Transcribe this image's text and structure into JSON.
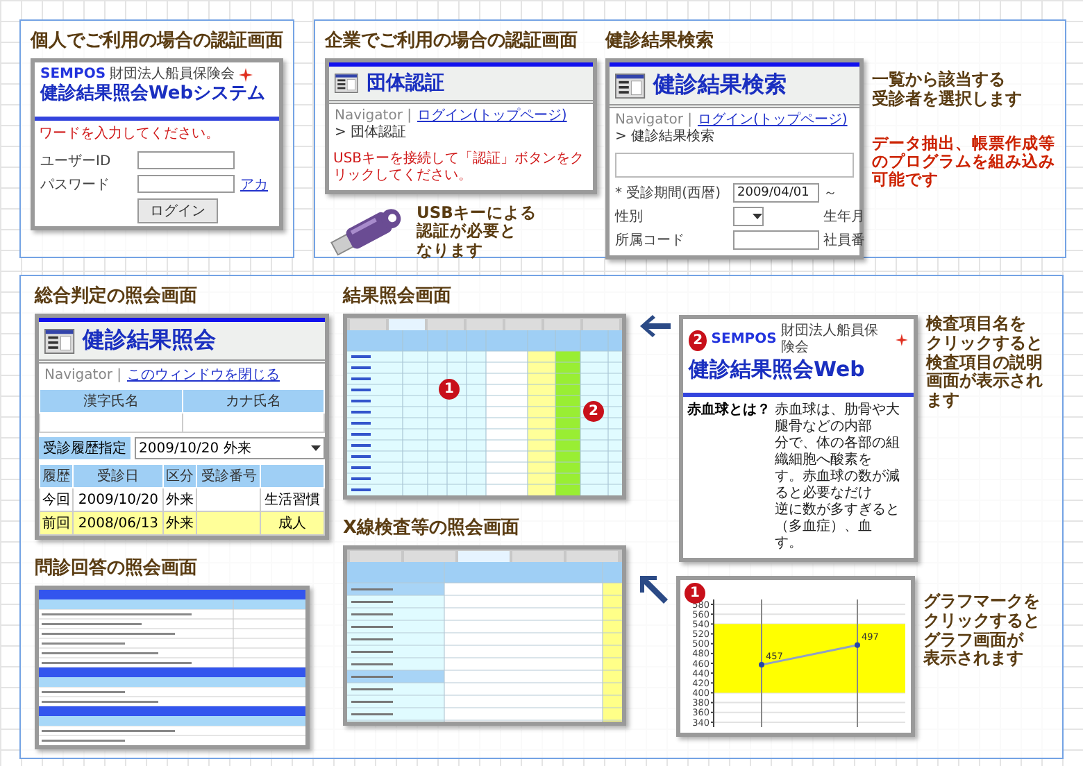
{
  "personal_auth": {
    "title": "個人でご利用の場合の認証画面",
    "brand": "SEMPOS",
    "org": "財団法人船員保険会",
    "system": "健診結果照会Webシステム",
    "message": "ワードを入力してください。",
    "fields": [
      {
        "label": "ユーザーID"
      },
      {
        "label": "パスワード"
      }
    ],
    "link": "アカ",
    "button": "ログイン"
  },
  "corporate_auth": {
    "title": "企業でご利用の場合の認証画面",
    "heading": "団体認証",
    "nav": {
      "label": "Navigator |",
      "link": "ログイン(トップページ)",
      "current": "> 団体認証"
    },
    "message": "USBキーを接続して「認証」ボタンをクリックしてください。",
    "caption": [
      "USBキーによる",
      "認証が必要と",
      "なります"
    ]
  },
  "search": {
    "title": "健診結果検索",
    "heading": "健診結果検索",
    "nav": {
      "label": "Navigator |",
      "link": "ログイン(トップページ)",
      "current": "> 健診結果検索"
    },
    "rows": [
      {
        "label": "* 受診期間(西暦)",
        "kind": "text",
        "value": "2009/04/01",
        "side": "～"
      },
      {
        "label": "性別",
        "kind": "select",
        "side": "生年月"
      },
      {
        "label": "所属コード",
        "kind": "text",
        "side": "社員番"
      }
    ],
    "caption": [
      "一覧から該当する",
      "受診者を選択します"
    ],
    "note": [
      "データ抽出、帳票作成等",
      "のプログラムを組み込み",
      "可能です"
    ]
  },
  "overall": {
    "title": "総合判定の照会画面",
    "heading": "健診結果照会",
    "nav": {
      "label": "Navigator |",
      "link": "このウィンドウを閉じる"
    },
    "name_columns": [
      "漢字氏名",
      "カナ氏名"
    ],
    "history": {
      "label": "受診履歴指定",
      "value": "2009/10/20 外来"
    },
    "columns": [
      "履歴",
      "受診日",
      "区分",
      "受診番号"
    ],
    "rows": [
      {
        "history": "今回",
        "date": "2009/10/20",
        "category": "外来",
        "column_5": "生活習慣",
        "highlighted": false
      },
      {
        "history": "前回",
        "date": "2008/06/13",
        "category": "外来",
        "column_5": "成人",
        "highlighted": true
      }
    ]
  },
  "results": {
    "title": "結果照会画面",
    "markers": [
      "1",
      "2"
    ]
  },
  "questionnaire": {
    "title": "問診回答の照会画面"
  },
  "xray": {
    "title": "X線検査等の照会画面"
  },
  "detail_popup": {
    "marker": "2",
    "brand": "SEMPOS",
    "org": "財団法人船員保険会",
    "system": "健診結果照会Web",
    "term": "赤血球とは？",
    "lines": [
      "赤血球は、肋骨や大腿骨などの内部",
      "分で、体の各部の組織細胞へ酸素を",
      "す。赤血球の数が減ると必要なだけ",
      "逆に数が多すぎると（多血症）、血",
      "す。"
    ]
  },
  "detail_caption": [
    "検査項目名を",
    "クリックすると",
    "検査項目の説明",
    "画面が表示され",
    "ます"
  ],
  "graph_popup": {
    "marker": "1",
    "chart_data": {
      "type": "line",
      "categories": [
        null,
        null
      ],
      "ylim": [
        330,
        590
      ],
      "yticks": [
        340,
        360,
        380,
        400,
        420,
        440,
        460,
        480,
        500,
        520,
        540,
        560,
        580
      ],
      "series": [
        {
          "color": "#8fa0c8",
          "marker": "circle",
          "values": [
            457,
            497
          ]
        }
      ],
      "data_labels": true,
      "grid": true,
      "bands": [
        {
          "axis": "y",
          "from": 400,
          "to": 540,
          "color": "#ffff00"
        }
      ]
    }
  },
  "graph_caption": [
    "グラフマークを",
    "クリックすると",
    "グラフ画面が",
    "表示されます"
  ]
}
